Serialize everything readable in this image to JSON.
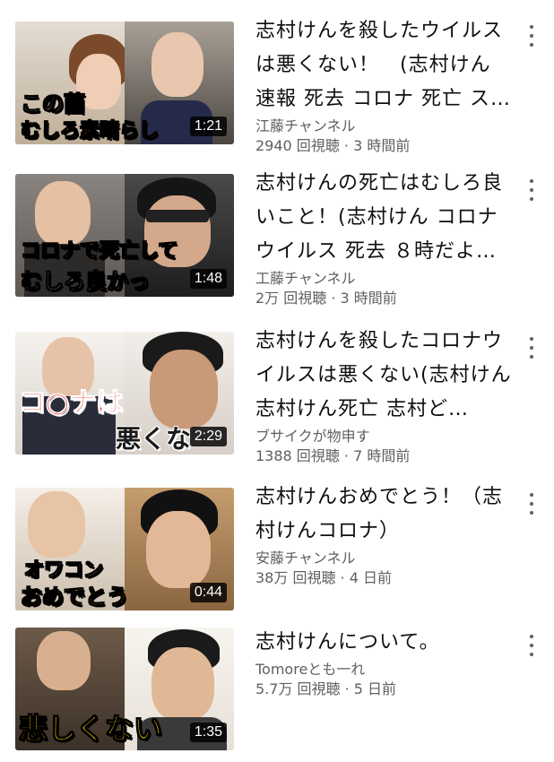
{
  "videos": [
    {
      "title": "志村けんを殺したウイルスは悪くない！　(志村けん 速報 死去 コロナ 死亡 ス…",
      "channel": "江藤チャンネル",
      "stats": "2940 回視聴 · 3 時間前",
      "duration": "1:21",
      "caption_top": "この菌",
      "caption_bottom": "むしろ素晴らし"
    },
    {
      "title": "志村けんの死亡はむしろ良いこと！(志村けん コロナ ウイルス 死去 ８時だよ…",
      "channel": "工藤チャンネル",
      "stats": "2万 回視聴 · 3 時間前",
      "duration": "1:48",
      "caption_top": "コロナで死亡して",
      "caption_bottom": "むしろ良かっ"
    },
    {
      "title": "志村けんを殺したコロナウイルスは悪くない(志村けん 志村けん死亡 志村ど…",
      "channel": "ブサイクが物申す",
      "stats": "1388 回視聴 · 7 時間前",
      "duration": "2:29",
      "caption_top": "コ○ナは",
      "caption_bottom": "悪くな"
    },
    {
      "title": "志村けんおめでとう！（志村けんコロナ）",
      "channel": "安藤チャンネル",
      "stats": "38万 回視聴 · 4 日前",
      "duration": "0:44",
      "caption_top": "オワコン",
      "caption_bottom": "おめでとう"
    },
    {
      "title": "志村けんについて。",
      "channel": "Tomoreとも一れ",
      "stats": "5.7万 回視聴 · 5 日前",
      "duration": "1:35",
      "caption_top": "",
      "caption_bottom": "悲しくない"
    }
  ],
  "colors": {
    "caption_white": "#ffffff",
    "caption_yellow": "#ffd400",
    "caption_orange": "#ff8c1a",
    "caption_red": "#e8281e"
  }
}
